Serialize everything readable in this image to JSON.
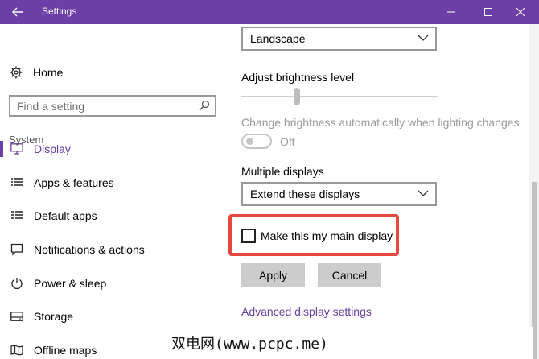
{
  "window": {
    "title": "Settings",
    "accent_color": "#6b3fa6"
  },
  "sidebar": {
    "home_label": "Home",
    "search_placeholder": "Find a setting",
    "section_label": "System",
    "items": [
      {
        "label": "Display",
        "icon": "monitor-icon",
        "selected": true
      },
      {
        "label": "Apps & features",
        "icon": "list-icon",
        "selected": false
      },
      {
        "label": "Default apps",
        "icon": "default-apps-icon",
        "selected": false
      },
      {
        "label": "Notifications & actions",
        "icon": "speech-bubble-icon",
        "selected": false
      },
      {
        "label": "Power & sleep",
        "icon": "power-icon",
        "selected": false
      },
      {
        "label": "Storage",
        "icon": "storage-icon",
        "selected": false
      },
      {
        "label": "Offline maps",
        "icon": "map-icon",
        "selected": false
      }
    ]
  },
  "main": {
    "orientation_value": "Landscape",
    "brightness_label": "Adjust brightness level",
    "brightness_level": 0.3,
    "auto_brightness_label": "Change brightness automatically when lighting changes",
    "auto_brightness_state": "Off",
    "multiple_displays_label": "Multiple displays",
    "multiple_displays_value": "Extend these displays",
    "main_display_checkbox_label": "Make this my main display",
    "main_display_checked": false,
    "apply_label": "Apply",
    "cancel_label": "Cancel",
    "advanced_link": "Advanced display settings",
    "highlight_color": "#e5483d"
  },
  "watermark": "双电网(www.pcpc.me)"
}
